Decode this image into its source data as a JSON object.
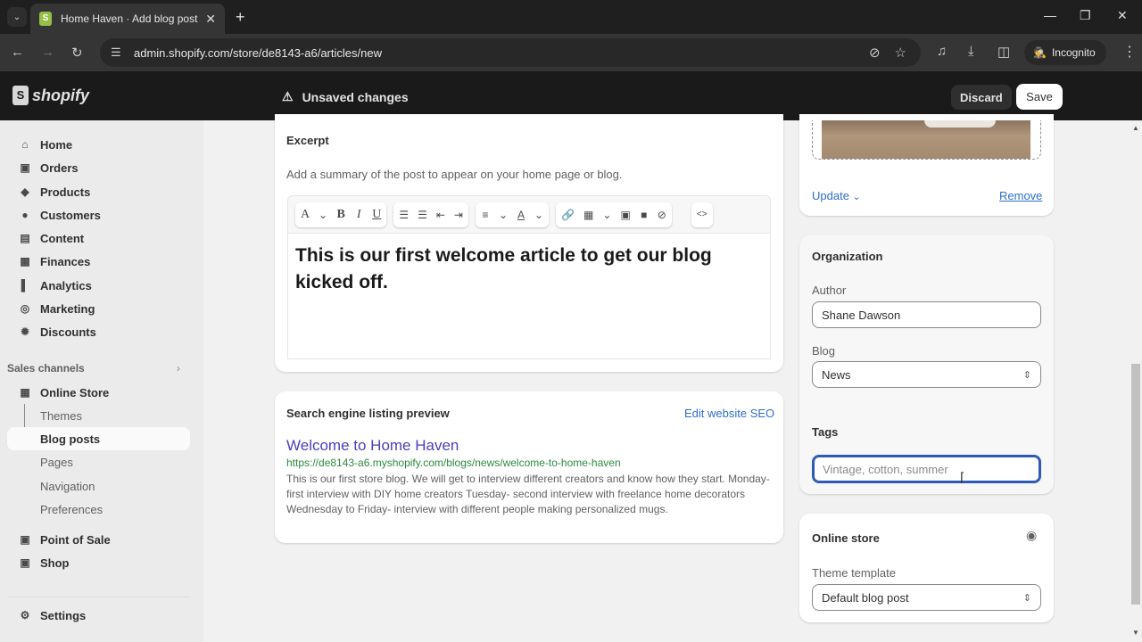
{
  "browser": {
    "tab_title": "Home Haven · Add blog post · ",
    "url": "admin.shopify.com/store/de8143-a6/articles/new",
    "incognito_label": "Incognito",
    "icons": [
      "tab-search-icon",
      "back-icon",
      "forward-icon",
      "reload-icon",
      "site-settings-icon",
      "eye-off-icon",
      "star-icon",
      "media-icon",
      "download-icon",
      "side-panel-icon",
      "incognito-icon",
      "kebab-icon"
    ]
  },
  "appbar": {
    "logo_text": "shopify",
    "unsaved_label": "Unsaved changes",
    "discard_label": "Discard",
    "save_label": "Save"
  },
  "sidebar": {
    "items": [
      {
        "label": "Home",
        "icon": "home-icon"
      },
      {
        "label": "Orders",
        "icon": "orders-icon"
      },
      {
        "label": "Products",
        "icon": "tag-icon"
      },
      {
        "label": "Customers",
        "icon": "person-icon"
      },
      {
        "label": "Content",
        "icon": "content-icon"
      },
      {
        "label": "Finances",
        "icon": "bank-icon"
      },
      {
        "label": "Analytics",
        "icon": "bar-chart-icon"
      },
      {
        "label": "Marketing",
        "icon": "target-icon"
      },
      {
        "label": "Discounts",
        "icon": "discount-icon"
      }
    ],
    "sales_channels_label": "Sales channels",
    "online_store_label": "Online Store",
    "sub_items": [
      "Themes",
      "Blog posts",
      "Pages",
      "Navigation",
      "Preferences"
    ],
    "active_sub": "Blog posts",
    "point_of_sale_label": "Point of Sale",
    "shop_label": "Shop",
    "settings_label": "Settings"
  },
  "excerpt": {
    "title": "Excerpt",
    "help": "Add a summary of the post to appear on your home page or blog.",
    "content": "This is our first welcome article to get our blog kicked off.",
    "toolbar": {
      "font_glyph": "A",
      "bold_glyph": "B",
      "italic_glyph": "I",
      "underline_glyph": "U",
      "color_glyph": "A",
      "code_glyph": "<>"
    }
  },
  "seo": {
    "title": "Search engine listing preview",
    "edit_link": "Edit website SEO",
    "page_title": "Welcome to Home Haven",
    "url": "https://de8143-a6.myshopify.com/blogs/news/welcome-to-home-haven",
    "description": "This is our first store blog. We will get to interview different creators and know how they start. Monday- first interview with DIY home creators Tuesday- second interview with freelance home decorators Wednesday to Friday- interview with different people making personalized mugs."
  },
  "image_card": {
    "update_label": "Update",
    "remove_label": "Remove"
  },
  "organization": {
    "title": "Organization",
    "author_label": "Author",
    "author_value": "Shane Dawson",
    "blog_label": "Blog",
    "blog_value": "News",
    "tags_label": "Tags",
    "tags_placeholder": "Vintage, cotton, summer",
    "tags_value": ""
  },
  "online_store": {
    "title": "Online store",
    "template_label": "Theme template",
    "template_value": "Default blog post"
  }
}
